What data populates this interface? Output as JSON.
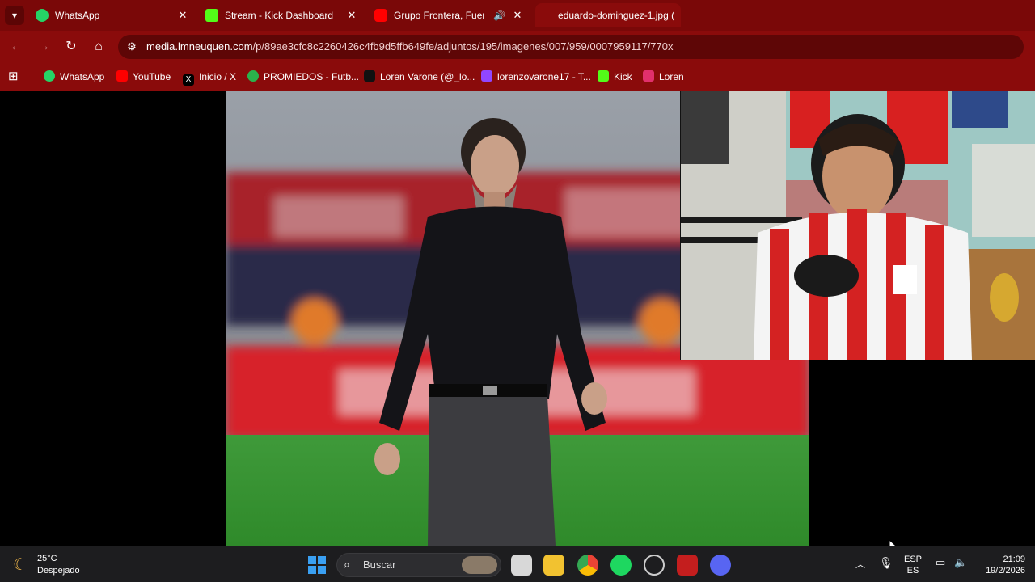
{
  "browser": {
    "tabs": [
      {
        "title": "WhatsApp",
        "icon": "whatsapp-icon",
        "close": "✕"
      },
      {
        "title": "Stream - Kick Dashboard",
        "icon": "kick-icon",
        "close": "✕"
      },
      {
        "title": "Grupo Frontera, Fuerza R",
        "icon": "youtube-icon",
        "close": "✕"
      },
      {
        "title": "eduardo-dominguez-1.jpg (",
        "icon": "image-icon",
        "close": ""
      }
    ],
    "address": {
      "host": "media.lmneuquen.com",
      "path": "/p/89ae3cfc8c2260426c4fb9d5ffb649fe/adjuntos/195/imagenes/007/959/0007959117/770x"
    },
    "bookmarks": [
      {
        "label": "WhatsApp",
        "icon": "whatsapp-icon",
        "color": "#25d366"
      },
      {
        "label": "YouTube",
        "icon": "youtube-icon",
        "color": "#ff0000"
      },
      {
        "label": "Inicio / X",
        "icon": "x-icon",
        "color": "#000000"
      },
      {
        "label": "PROMIEDOS - Futb...",
        "icon": "promiedos-icon",
        "color": "#2bb24c"
      },
      {
        "label": "Loren Varone (@_lo...",
        "icon": "tiktok-icon",
        "color": "#111111"
      },
      {
        "label": "lorenzovarone17 - T...",
        "icon": "twitch-icon",
        "color": "#9146ff"
      },
      {
        "label": "Kick",
        "icon": "kick-icon",
        "color": "#53fc18"
      },
      {
        "label": "Loren",
        "icon": "instagram-icon",
        "color": "#e1306c"
      }
    ],
    "accent": "#8a0b0b"
  },
  "taskbar": {
    "weather": {
      "temp": "25°C",
      "condition": "Despejado"
    },
    "search_placeholder": "Buscar",
    "language": {
      "top": "ESP",
      "bottom": "ES"
    },
    "clock": {
      "time": "21:09",
      "date": "19/2/2026"
    }
  }
}
